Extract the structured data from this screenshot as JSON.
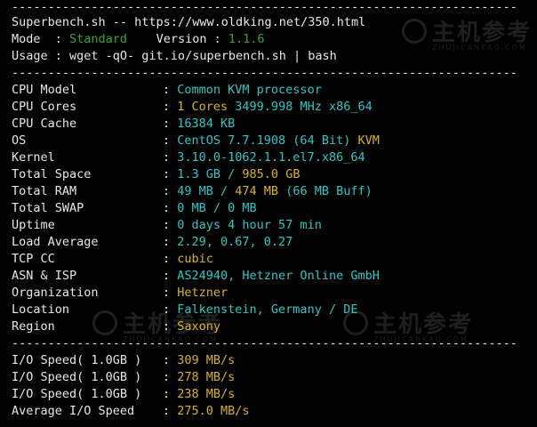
{
  "watermark": {
    "cn": "主机参考",
    "en": "ZHUJICANKAO.COM"
  },
  "header": {
    "title": "Superbench.sh -- https://www.oldking.net/350.html",
    "mode_label": "Mode  : ",
    "mode_value": "Standard",
    "version_label": "    Version : ",
    "version_value": "1.1.6",
    "usage": "Usage : wget -qO- git.io/superbench.sh | bash"
  },
  "separator": "----------------------------------------------------------------------",
  "sep_char": ":",
  "info": [
    {
      "label": "CPU Model",
      "parts": [
        {
          "text": "Common KVM processor",
          "color": "cyan"
        }
      ]
    },
    {
      "label": "CPU Cores",
      "parts": [
        {
          "text": "1 Cores ",
          "color": "yellow"
        },
        {
          "text": "3499.998 MHz x86_64",
          "color": "cyan"
        }
      ]
    },
    {
      "label": "CPU Cache",
      "parts": [
        {
          "text": "16384 KB",
          "color": "cyan"
        }
      ]
    },
    {
      "label": "OS",
      "parts": [
        {
          "text": "CentOS 7.7.1908 (64 Bit) ",
          "color": "cyan"
        },
        {
          "text": "KVM",
          "color": "yellow"
        }
      ]
    },
    {
      "label": "Kernel",
      "parts": [
        {
          "text": "3.10.0-1062.1.1.el7.x86_64",
          "color": "cyan"
        }
      ]
    },
    {
      "label": "Total Space",
      "parts": [
        {
          "text": "1.3 GB / ",
          "color": "cyan"
        },
        {
          "text": "985.0 GB",
          "color": "yellow"
        }
      ]
    },
    {
      "label": "Total RAM",
      "parts": [
        {
          "text": "49 MB / ",
          "color": "cyan"
        },
        {
          "text": "474 MB",
          "color": "yellow"
        },
        {
          "text": " (66 MB Buff)",
          "color": "cyan"
        }
      ]
    },
    {
      "label": "Total SWAP",
      "parts": [
        {
          "text": "0 MB / 0 MB",
          "color": "cyan"
        }
      ]
    },
    {
      "label": "Uptime",
      "parts": [
        {
          "text": "0 days 4 hour 57 min",
          "color": "cyan"
        }
      ]
    },
    {
      "label": "Load Average",
      "parts": [
        {
          "text": "2.29, 0.67, 0.27",
          "color": "cyan"
        }
      ]
    },
    {
      "label": "TCP CC",
      "parts": [
        {
          "text": "cubic",
          "color": "yellow"
        }
      ]
    },
    {
      "label": "ASN & ISP",
      "parts": [
        {
          "text": "AS24940, Hetzner Online GmbH",
          "color": "cyan"
        }
      ]
    },
    {
      "label": "Organization",
      "parts": [
        {
          "text": "Hetzner",
          "color": "yellow"
        }
      ]
    },
    {
      "label": "Location",
      "parts": [
        {
          "text": "Falkenstein, Germany / DE",
          "color": "cyan"
        }
      ]
    },
    {
      "label": "Region",
      "parts": [
        {
          "text": "Saxony",
          "color": "yellow"
        }
      ]
    }
  ],
  "io": [
    {
      "label": "I/O Speed( 1.0GB )",
      "value": "309 MB/s"
    },
    {
      "label": "I/O Speed( 1.0GB )",
      "value": "278 MB/s"
    },
    {
      "label": "I/O Speed( 1.0GB )",
      "value": "238 MB/s"
    },
    {
      "label": "Average I/O Speed",
      "value": "275.0 MB/s"
    }
  ],
  "colors": {
    "white": "#e8e8e8",
    "cyan": "#2fc6c6",
    "yellow": "#d9b228",
    "green": "#3aa33a",
    "background": "#000000"
  }
}
